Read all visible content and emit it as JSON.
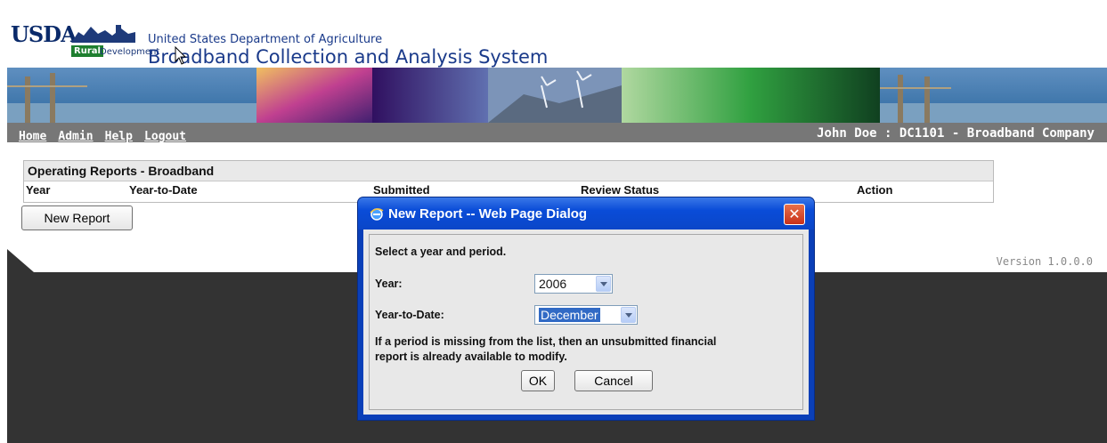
{
  "header": {
    "agency_short": "USDA",
    "agency_sub_1": "Rural",
    "agency_sub_2": "Development",
    "department": "United States Department of Agriculture",
    "system_title": "Broadband Collection and Analysis System"
  },
  "nav": {
    "links": [
      "Home",
      "Admin",
      "Help",
      "Logout"
    ],
    "user_info": "John Doe : DC1101 - Broadband Company"
  },
  "reports_panel": {
    "title": "Operating Reports - Broadband",
    "columns": [
      "Year",
      "Year-to-Date",
      "Submitted",
      "Review Status",
      "Action"
    ],
    "new_report_label": "New Report"
  },
  "footer": {
    "version": "Version 1.0.0.0"
  },
  "dialog": {
    "title": "New Report -- Web Page Dialog",
    "close_label": "✕",
    "instruction": "Select a year and period.",
    "year_label": "Year:",
    "year_value": "2006",
    "ytd_label": "Year-to-Date:",
    "ytd_value": "December",
    "note_line1": "If a period is missing from the list, then an unsubmitted financial",
    "note_line2": "report is already available to modify.",
    "ok_label": "OK",
    "cancel_label": "Cancel"
  },
  "colors": {
    "nav_bg": "#777777",
    "dark_bg": "#333333",
    "dialog_title_bg": "#0a46c8",
    "title_text": "#1a3a8a"
  }
}
